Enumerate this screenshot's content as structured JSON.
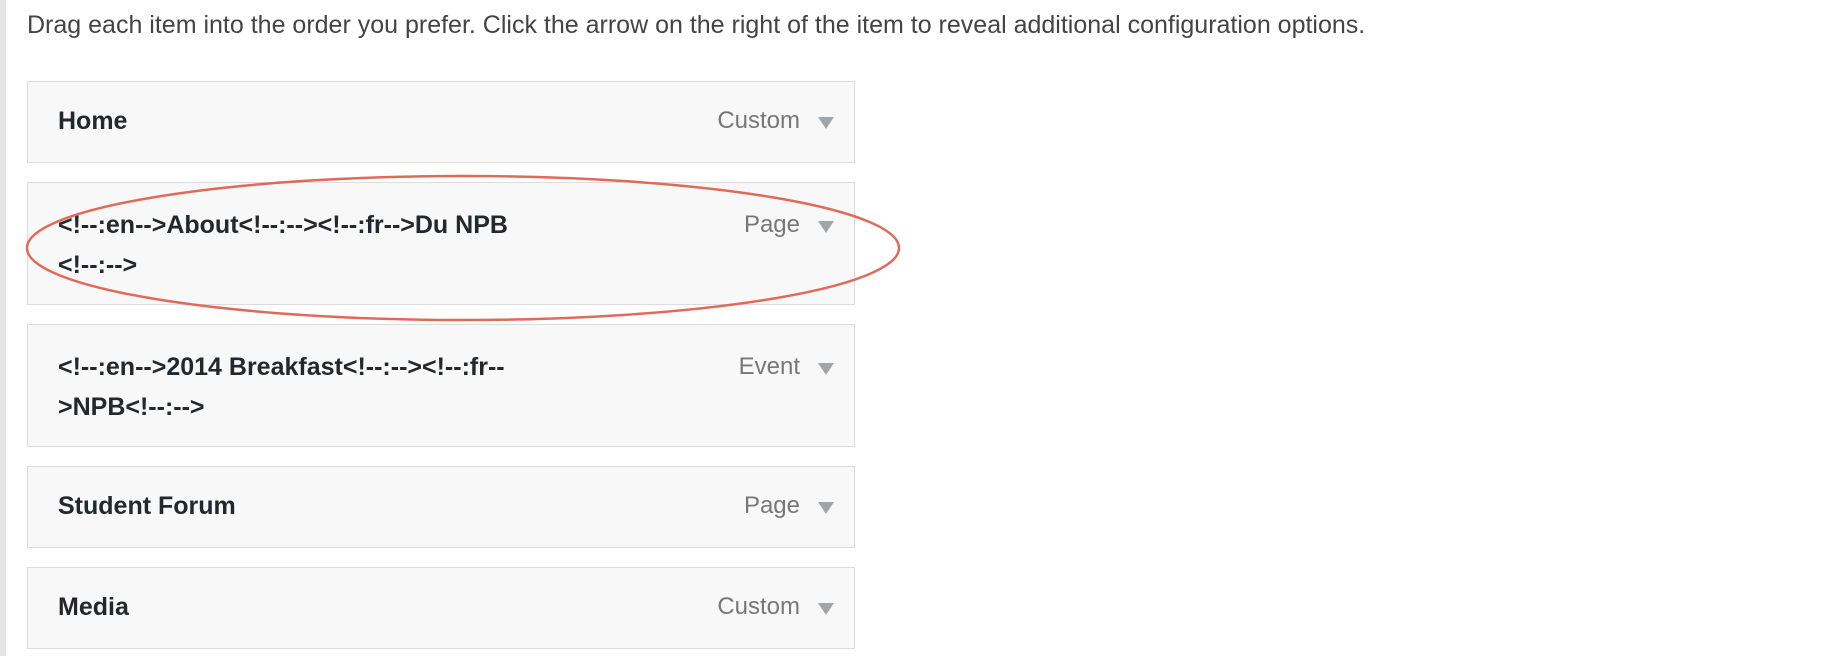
{
  "instructions": "Drag each item into the order you prefer. Click the arrow on the right of the item to reveal additional configuration options.",
  "menu_items": [
    {
      "title": "Home",
      "type": "Custom"
    },
    {
      "title": "<!--:en-->About<!--:--><!--:fr-->Du NPB<!--:-->",
      "type": "Page"
    },
    {
      "title": "<!--:en-->2014 Breakfast<!--:--><!--:fr-->NPB<!--:-->",
      "type": "Event"
    },
    {
      "title": "Student Forum",
      "type": "Page"
    },
    {
      "title": "Media",
      "type": "Custom"
    }
  ],
  "colors": {
    "highlight": "#e06a5a",
    "item_background": "#f8f8f8",
    "item_border": "#dcdcdc",
    "arrow": "#a0a5aa"
  },
  "icons": {
    "toggle": "triangle-down-icon"
  }
}
